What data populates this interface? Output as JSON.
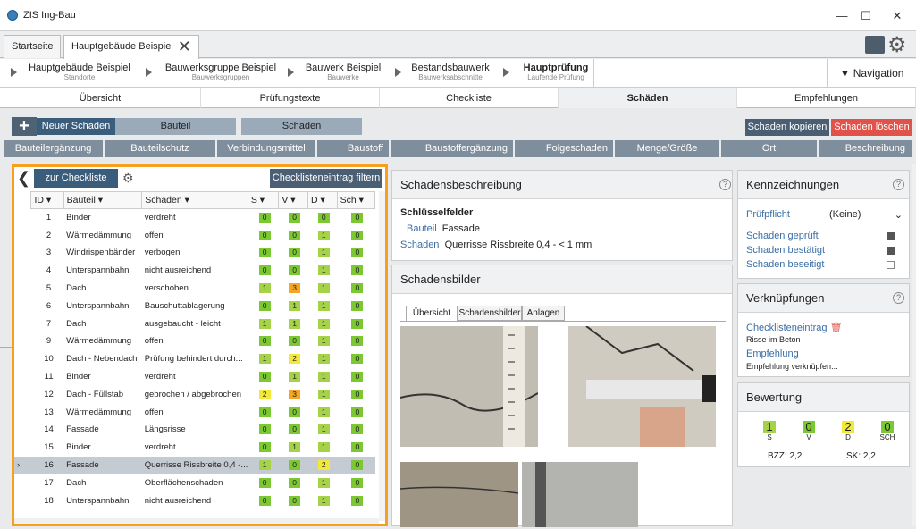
{
  "app": {
    "title": "ZIS Ing-Bau"
  },
  "window": {
    "minimize": "—",
    "maximize": "☐",
    "close": "✕"
  },
  "tabs": [
    {
      "label": "Startseite"
    },
    {
      "label": "Hauptgebäude Beispiel"
    }
  ],
  "breadcrumb": [
    {
      "title": "Hauptgebäude Beispiel",
      "sub": "Standorte"
    },
    {
      "title": "Bauwerksgruppe Beispiel",
      "sub": "Bauwerksgruppen"
    },
    {
      "title": "Bauwerk Beispiel",
      "sub": "Bauwerke"
    },
    {
      "title": "Bestandsbauwerk",
      "sub": "Bauwerksabschnitte"
    },
    {
      "title": "Hauptprüfung",
      "sub": "Laufende Prüfung"
    }
  ],
  "navigation": "▼ Navigation",
  "sections": [
    "Übersicht",
    "Prüfungstexte",
    "Checkliste",
    "Schäden",
    "Empfehlungen"
  ],
  "toolbar": {
    "new": "Neuer Schaden",
    "bauteil": "Bauteil",
    "schaden": "Schaden",
    "copy": "Schaden kopieren",
    "delete": "Schaden löschen"
  },
  "subtabs": [
    "Bauteilergänzung",
    "Bauteilschutz",
    "Verbindungsmittel",
    "Baustoff",
    "Baustoffergänzung",
    "Folgeschaden",
    "Menge/Größe",
    "Ort",
    "Beschreibung"
  ],
  "list": {
    "back": "zur Checkliste",
    "filter": "Checklisteneintrag filtern",
    "columns": [
      "ID",
      "Bauteil",
      "Schaden",
      "S",
      "V",
      "D",
      "Sch"
    ],
    "rows": [
      {
        "id": "1",
        "bauteil": "Binder",
        "schaden": "verdreht",
        "s": "0",
        "v": "0",
        "d": "0",
        "sch": "0"
      },
      {
        "id": "2",
        "bauteil": "Wärmedämmung",
        "schaden": "offen",
        "s": "0",
        "v": "0",
        "d": "1",
        "sch": "0"
      },
      {
        "id": "3",
        "bauteil": "Windrispenbänder",
        "schaden": "verbogen",
        "s": "0",
        "v": "0",
        "d": "1",
        "sch": "0"
      },
      {
        "id": "4",
        "bauteil": "Unterspannbahn",
        "schaden": "nicht ausreichend",
        "s": "0",
        "v": "0",
        "d": "1",
        "sch": "0"
      },
      {
        "id": "5",
        "bauteil": "Dach",
        "schaden": "verschoben",
        "s": "1",
        "v": "3",
        "d": "1",
        "sch": "0"
      },
      {
        "id": "6",
        "bauteil": "Unterspannbahn",
        "schaden": "Bauschuttablagerung",
        "s": "0",
        "v": "1",
        "d": "1",
        "sch": "0"
      },
      {
        "id": "7",
        "bauteil": "Dach",
        "schaden": "ausgebaucht - leicht",
        "s": "1",
        "v": "1",
        "d": "1",
        "sch": "0"
      },
      {
        "id": "9",
        "bauteil": "Wärmedämmung",
        "schaden": "offen",
        "s": "0",
        "v": "0",
        "d": "1",
        "sch": "0"
      },
      {
        "id": "10",
        "bauteil": "Dach - Nebendach",
        "schaden": "Prüfung behindert durch...",
        "s": "1",
        "v": "2",
        "d": "1",
        "sch": "0"
      },
      {
        "id": "11",
        "bauteil": "Binder",
        "schaden": "verdreht",
        "s": "0",
        "v": "1",
        "d": "1",
        "sch": "0"
      },
      {
        "id": "12",
        "bauteil": "Dach - Füllstab",
        "schaden": "gebrochen / abgebrochen",
        "s": "2",
        "v": "3",
        "d": "1",
        "sch": "0"
      },
      {
        "id": "13",
        "bauteil": "Wärmedämmung",
        "schaden": "offen",
        "s": "0",
        "v": "0",
        "d": "1",
        "sch": "0"
      },
      {
        "id": "14",
        "bauteil": "Fassade",
        "schaden": "Längsrisse",
        "s": "0",
        "v": "0",
        "d": "1",
        "sch": "0"
      },
      {
        "id": "15",
        "bauteil": "Binder",
        "schaden": "verdreht",
        "s": "0",
        "v": "1",
        "d": "1",
        "sch": "0"
      },
      {
        "id": "16",
        "bauteil": "Fassade",
        "schaden": "Querrisse Rissbreite 0,4 -...",
        "s": "1",
        "v": "0",
        "d": "2",
        "sch": "0"
      },
      {
        "id": "17",
        "bauteil": "Dach",
        "schaden": "Oberflächenschaden",
        "s": "0",
        "v": "0",
        "d": "1",
        "sch": "0"
      },
      {
        "id": "18",
        "bauteil": "Unterspannbahn",
        "schaden": "nicht ausreichend",
        "s": "0",
        "v": "0",
        "d": "1",
        "sch": "0"
      }
    ]
  },
  "beschreibung": {
    "title": "Schadensbeschreibung",
    "key": "Schlüsselfelder",
    "bauteil_label": "Bauteil",
    "bauteil": "Fassade",
    "schaden_label": "Schaden",
    "schaden": "Querrisse Rissbreite 0,4 - < 1 mm"
  },
  "bilder": {
    "title": "Schadensbilder",
    "tabs": [
      "Übersicht",
      "Schadensbilder",
      "Anlagen"
    ]
  },
  "kennz": {
    "title": "Kennzeichnungen",
    "pflicht_label": "Prüfpflicht",
    "pflicht": "(Keine)",
    "geprueft": "Schaden geprüft",
    "bestaetigt": "Schaden bestätigt",
    "beseitigt": "Schaden beseitigt"
  },
  "verkn": {
    "title": "Verknüpfungen",
    "cl": "Checklisteneintrag",
    "cl_sub": "Risse im Beton",
    "emp": "Empfehlung",
    "emp_sub": "Empfehlung verknüpfen..."
  },
  "bewertung": {
    "title": "Bewertung",
    "vals": [
      {
        "v": "1",
        "l": "S"
      },
      {
        "v": "0",
        "l": "V"
      },
      {
        "v": "2",
        "l": "D"
      },
      {
        "v": "0",
        "l": "SCH"
      }
    ],
    "bzz": "BZZ: 2,2",
    "sk": "SK: 2,2"
  },
  "colors": {
    "accent": "#3b5d7c",
    "orange": "#f5a020",
    "delete": "#e0534a",
    "green": "#7cc832",
    "yellow": "#f2e83a"
  }
}
